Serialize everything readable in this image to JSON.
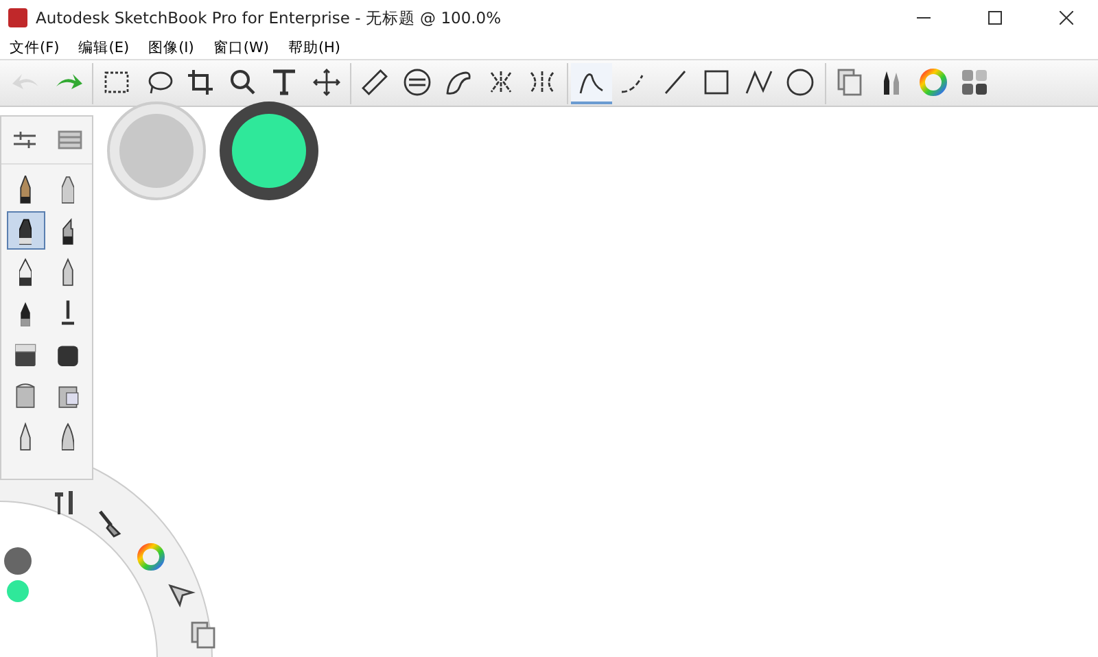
{
  "window": {
    "title": "Autodesk SketchBook Pro for Enterprise - 无标题 @ 100.0%"
  },
  "menu": [
    "文件(F)",
    "编辑(E)",
    "图像(I)",
    "窗口(W)",
    "帮助(H)"
  ],
  "tools": [
    {
      "kind": "undo",
      "selected": false,
      "disabled": true
    },
    {
      "kind": "redo",
      "selected": false,
      "disabled": false
    },
    {
      "kind": "rect-select",
      "selected": false,
      "disabled": false
    },
    {
      "kind": "lasso",
      "selected": false,
      "disabled": false
    },
    {
      "kind": "crop",
      "selected": false,
      "disabled": false
    },
    {
      "kind": "zoom",
      "selected": false,
      "disabled": false
    },
    {
      "kind": "text",
      "selected": false,
      "disabled": false
    },
    {
      "kind": "move",
      "selected": false,
      "disabled": false
    },
    {
      "kind": "ruler",
      "selected": false,
      "disabled": false
    },
    {
      "kind": "ellipse-guide",
      "selected": false,
      "disabled": false
    },
    {
      "kind": "french-curve",
      "selected": false,
      "disabled": false
    },
    {
      "kind": "symmetry-x",
      "selected": false,
      "disabled": false
    },
    {
      "kind": "symmetry-y",
      "selected": false,
      "disabled": false
    },
    {
      "kind": "freehand",
      "selected": true,
      "disabled": false
    },
    {
      "kind": "curve",
      "selected": false,
      "disabled": false
    },
    {
      "kind": "line",
      "selected": false,
      "disabled": false
    },
    {
      "kind": "square",
      "selected": false,
      "disabled": false
    },
    {
      "kind": "polyline",
      "selected": false,
      "disabled": false
    },
    {
      "kind": "circle",
      "selected": false,
      "disabled": false
    },
    {
      "kind": "layers",
      "selected": false,
      "disabled": false
    },
    {
      "kind": "brushes",
      "selected": false,
      "disabled": false
    },
    {
      "kind": "color-wheel",
      "selected": false,
      "disabled": false
    },
    {
      "kind": "copic",
      "selected": false,
      "disabled": false
    }
  ],
  "brushes": [
    {
      "kind": "pencil",
      "selected": false
    },
    {
      "kind": "airbrush",
      "selected": false
    },
    {
      "kind": "marker",
      "selected": true
    },
    {
      "kind": "chisel",
      "selected": false
    },
    {
      "kind": "pen",
      "selected": false
    },
    {
      "kind": "ink",
      "selected": false
    },
    {
      "kind": "felt",
      "selected": false
    },
    {
      "kind": "smudge",
      "selected": false
    },
    {
      "kind": "eraser",
      "selected": false
    },
    {
      "kind": "eraser-hard",
      "selected": false
    },
    {
      "kind": "bucket",
      "selected": false
    },
    {
      "kind": "bucket-fill",
      "selected": false
    },
    {
      "kind": "fine",
      "selected": false
    },
    {
      "kind": "cone",
      "selected": false
    }
  ],
  "swatches": [
    {
      "color": "#c8c8c8"
    },
    {
      "color": "#2fe89a"
    }
  ],
  "lagoon": [
    {
      "kind": "tools"
    },
    {
      "kind": "brush"
    },
    {
      "kind": "color-wheel"
    },
    {
      "kind": "select"
    },
    {
      "kind": "layers"
    }
  ]
}
